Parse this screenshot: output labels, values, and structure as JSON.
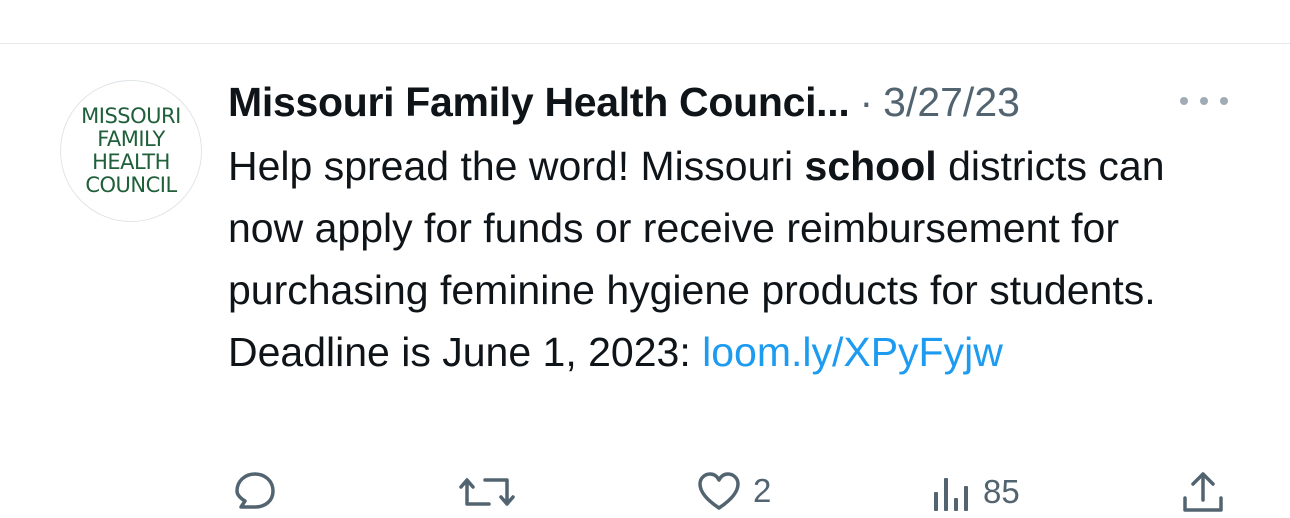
{
  "avatar": {
    "logo_lines": [
      "MISSOURI",
      "FAMILY",
      "HEALTH",
      "COUNCIL"
    ],
    "logo_color": "#1f5f3a"
  },
  "tweet": {
    "author_name": "Missouri Family Health Counci...",
    "separator": "·",
    "date": "3/27/23",
    "text_parts": {
      "before_bold": "Help spread the word! Missouri ",
      "bold": "school",
      "after_bold": " districts can now apply for funds or receive reimbursement for purchasing feminine hygiene products for students. Deadline is June 1, 2023: ",
      "link": "loom.ly/XPyFyjw"
    }
  },
  "actions": {
    "reply": {
      "icon": "reply-icon",
      "count": ""
    },
    "retweet": {
      "icon": "retweet-icon",
      "count": ""
    },
    "like": {
      "icon": "heart-icon",
      "count": "2"
    },
    "views": {
      "icon": "views-icon",
      "count": "85"
    },
    "share": {
      "icon": "share-icon",
      "count": ""
    }
  },
  "colors": {
    "text": "#0f1419",
    "secondary": "#536471",
    "link": "#1d9bf0",
    "divider": "#e6e9eb"
  }
}
